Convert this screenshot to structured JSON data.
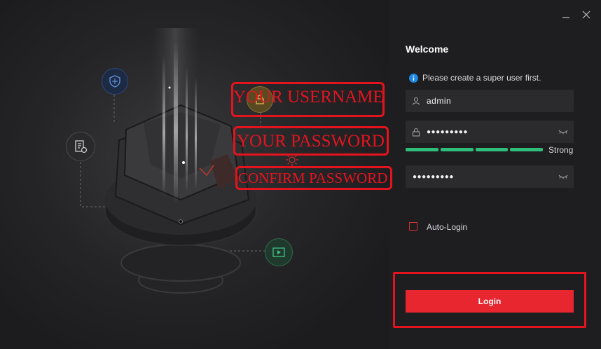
{
  "window": {
    "minimize_icon": "minimize-icon",
    "close_icon": "close-icon"
  },
  "login": {
    "title": "Welcome",
    "notice": "Please create a super user first.",
    "username": "admin",
    "password_mask": "●●●●●●●●●",
    "confirm_mask": "●●●●●●●●●",
    "strength_label": "Strong",
    "strength_level": 1.0,
    "auto_login_label": "Auto-Login",
    "auto_login_checked": false,
    "login_button": "Login"
  },
  "annotations": {
    "username": "YOUR USERNAME",
    "password": "YOUR PASSWORD",
    "confirm": "CONFIRM PASSWORD"
  },
  "colors": {
    "accent": "#e8262f",
    "strength": "#2fbd7a",
    "info": "#1e88e5",
    "annotation": "#e4141f"
  }
}
